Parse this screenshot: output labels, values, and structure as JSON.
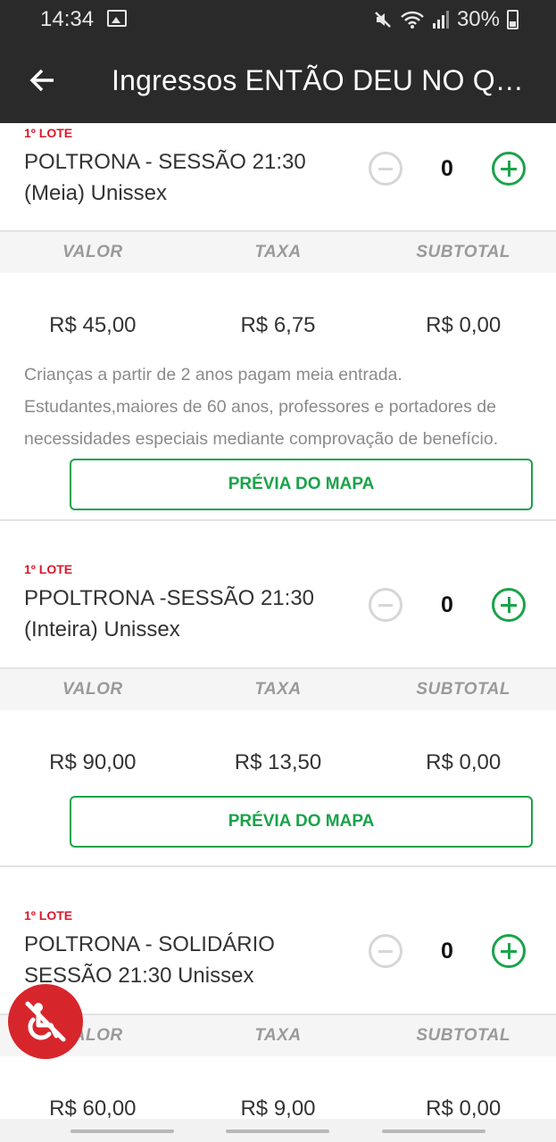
{
  "status_bar": {
    "time": "14:34",
    "battery": "30%",
    "icons": [
      "image-icon",
      "mute-icon",
      "wifi-icon",
      "signal-icon",
      "battery-icon"
    ]
  },
  "header": {
    "title": "Ingressos ENTÃO DEU NO QUE DEU",
    "back_icon": "arrow-left-icon"
  },
  "price_labels": {
    "valor": "VALOR",
    "taxa": "TAXA",
    "subtotal": "SUBTOTAL"
  },
  "tickets": [
    {
      "lote": "1º LOTE",
      "name_line1": "POLTRONA - SESSÃO 21:30",
      "name_line2": "(Meia) Unissex",
      "quantity": "0",
      "valor": "R$ 45,00",
      "taxa": "R$ 6,75",
      "subtotal": "R$ 0,00",
      "description": "Crianças a partir de 2 anos pagam meia entrada. Estudantes,maiores de 60 anos, professores e portadores de necessidades especiais mediante comprovação de benefício.",
      "map_button": "PRÉVIA DO MAPA"
    },
    {
      "lote": "1º LOTE",
      "name_line1": "PPOLTRONA -SESSÃO 21:30",
      "name_line2": "(Inteira) Unissex",
      "quantity": "0",
      "valor": "R$ 90,00",
      "taxa": "R$ 13,50",
      "subtotal": "R$ 0,00",
      "map_button": "PRÉVIA DO MAPA"
    },
    {
      "lote": "1º LOTE",
      "name_line1": "POLTRONA - SOLIDÁRIO",
      "name_line2": "SESSÃO 21:30 Unissex",
      "quantity": "0",
      "valor": "R$ 60,00",
      "taxa": "R$ 9,00",
      "subtotal": "R$ 0,00"
    }
  ],
  "accessibility_button": {
    "icon": "wheelchair-icon"
  },
  "colors": {
    "accent": "#1aa34a",
    "lote": "#d8192a",
    "header_bg": "#2a2a2a",
    "a11y": "#d7262b"
  }
}
